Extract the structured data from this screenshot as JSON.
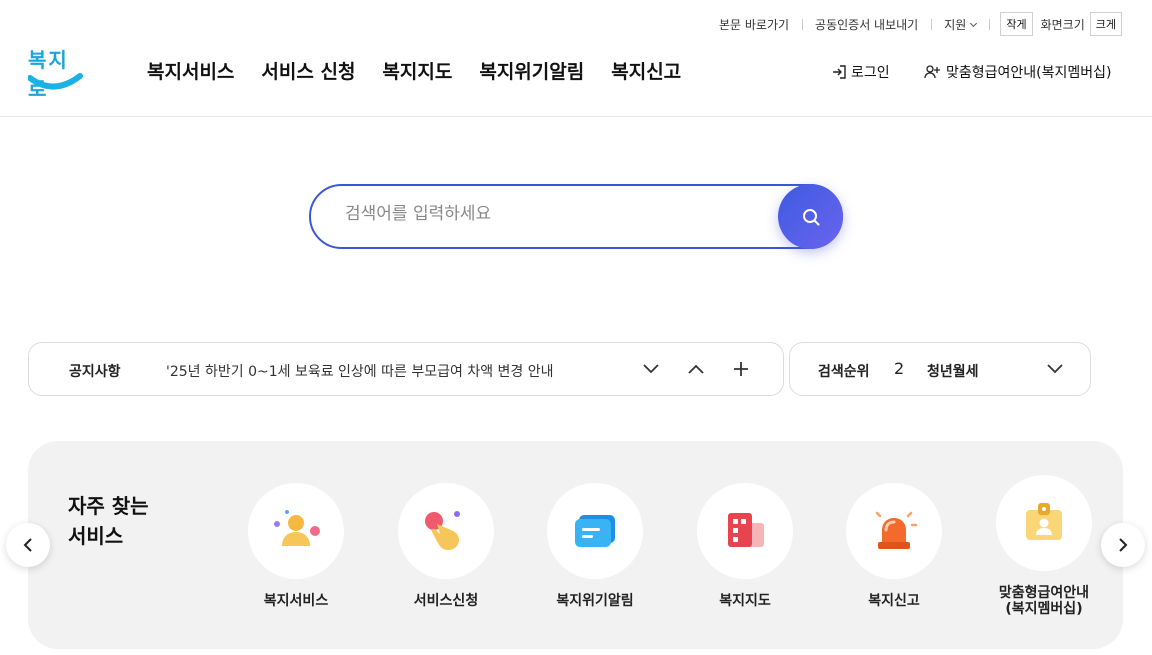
{
  "utility": {
    "skip_to_content": "본문 바로가기",
    "export_cert": "공동인증서 내보내기",
    "support": "지원",
    "font_small": "작게",
    "font_size_label": "화면크기",
    "font_large": "크게"
  },
  "logo": {
    "text": "복지로"
  },
  "gnb": [
    "복지서비스",
    "서비스 신청",
    "복지지도",
    "복지위기알림",
    "복지신고"
  ],
  "header": {
    "login": "로그인",
    "member": "맞춤형급여안내(복지멤버십)"
  },
  "search": {
    "placeholder": "검색어를 입력하세요"
  },
  "notice": {
    "label": "공지사항",
    "text": "'25년 하반기 0~1세 보육료 인상에 따른 부모급여 차액 변경 안내"
  },
  "rank": {
    "label": "검색순위",
    "number": "2",
    "term": "청년월세"
  },
  "favorites": {
    "title_line1": "자주 찾는",
    "title_line2": "서비스",
    "items": [
      {
        "label": "복지서비스",
        "icon": "person-icon"
      },
      {
        "label": "서비스신청",
        "icon": "hand-tap-icon"
      },
      {
        "label": "복지위기알림",
        "icon": "message-icon"
      },
      {
        "label": "복지지도",
        "icon": "building-icon"
      },
      {
        "label": "복지신고",
        "icon": "siren-icon"
      },
      {
        "label": "맞춤형급여안내",
        "label2": "(복지멤버십)",
        "icon": "id-badge-icon"
      }
    ]
  },
  "colors": {
    "brand_blue": "#3b57d6",
    "accent_purple": "#6b63ee",
    "logo_cyan": "#1aa6d8"
  }
}
